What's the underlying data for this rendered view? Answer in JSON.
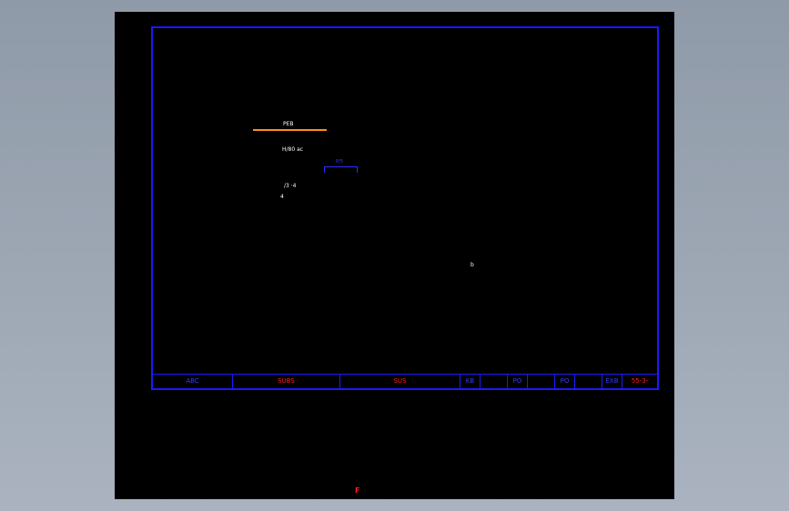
{
  "drawing": {
    "annotation_top": "PEB",
    "annotation_sub": "H/80 ac",
    "bracket_label": "P/5",
    "annotation_mid": "/3 ·4",
    "annotation_low": "4",
    "annotation_center": "b"
  },
  "title_block": {
    "cells": [
      "ABC",
      "SUBS",
      "SUS",
      "KB",
      "",
      "PO",
      "",
      "PO",
      "",
      "EXB",
      "55-3-"
    ],
    "red_cells": [
      1,
      2,
      10
    ]
  },
  "bottom_mark": "F",
  "colors": {
    "canvas": "#000000",
    "frame": "#1a1aff",
    "accent_orange": "#ff8c1a",
    "title_red": "#ff2020"
  }
}
